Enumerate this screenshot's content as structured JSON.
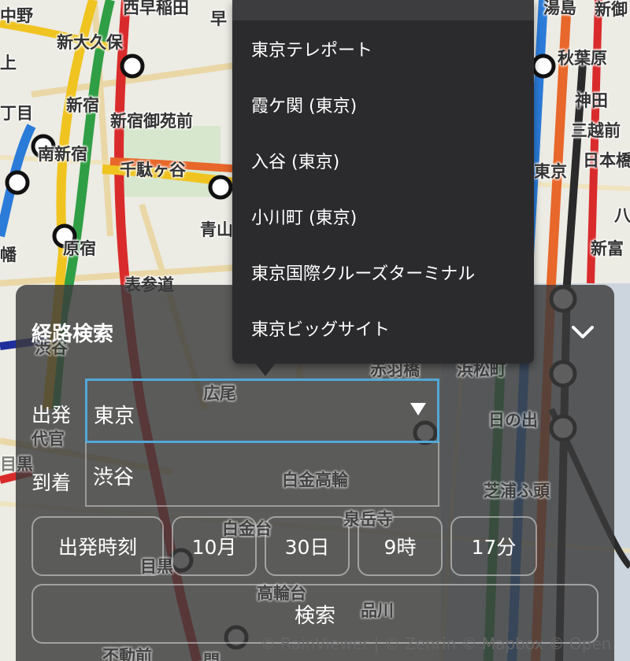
{
  "map": {
    "station_labels": [
      "中野",
      "西早稲田",
      "早",
      "湯島",
      "新御",
      "新大久保",
      "秋葉原",
      "上",
      "新宿",
      "神田",
      "丁目",
      "新宿御苑前",
      "三越前",
      "南新宿",
      "日本橋",
      "千駄ヶ谷",
      "東京",
      "青山",
      "八",
      "幡",
      "原宿",
      "新富",
      "表参道",
      "渋谷",
      "赤羽橋",
      "浜松町",
      "広尾",
      "日の出",
      "代官",
      "目黒",
      "白金高輪",
      "芝浦ふ頭",
      "白金台",
      "泉岳寺",
      "目黒",
      "高輪台",
      "品川",
      "不動前",
      "門"
    ],
    "attribution": "© RainViewer | © Zenrin © Mapbox © Open"
  },
  "dropdown": {
    "items": [
      "東京テレポート",
      "霞ケ関 (東京)",
      "入谷 (東京)",
      "小川町 (東京)",
      "東京国際クルーズターミナル",
      "東京ビッグサイト"
    ]
  },
  "panel": {
    "title": "経路検索",
    "from_label": "出発",
    "from_value": "東京",
    "to_label": "到着",
    "to_value": "渋谷",
    "time_type": "出発時刻",
    "month": "10月",
    "day": "30日",
    "hour": "9時",
    "minute": "17分",
    "search_label": "検索"
  }
}
